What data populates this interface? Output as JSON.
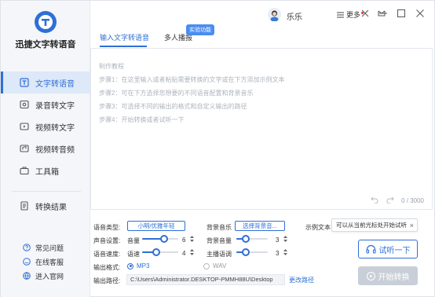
{
  "app": {
    "name": "迅捷文字转语音"
  },
  "colors": {
    "accent": "#2f6fd6",
    "sidebar_bg": "#f4f6f9",
    "active_bg": "#dde8f8",
    "badge": "#4a8df0"
  },
  "sidebar": {
    "items": [
      {
        "label": "文字转语音",
        "icon": "text-to-speech-icon",
        "active": true
      },
      {
        "label": "录音转文字",
        "icon": "recording-icon",
        "active": false
      },
      {
        "label": "视频转文字",
        "icon": "video-text-icon",
        "active": false
      },
      {
        "label": "视频转音频",
        "icon": "video-audio-icon",
        "active": false
      },
      {
        "label": "工具箱",
        "icon": "toolbox-icon",
        "active": false
      }
    ],
    "result": {
      "label": "转换结果",
      "icon": "result-icon"
    },
    "bottom_links": [
      {
        "label": "常见问题",
        "icon": "question-icon"
      },
      {
        "label": "在线客服",
        "icon": "support-icon"
      },
      {
        "label": "进入官网",
        "icon": "website-icon"
      }
    ]
  },
  "header": {
    "username": "乐乐",
    "more_label": "更多"
  },
  "tabs": {
    "input_text": "输入文字转语音",
    "multi_voice": "多人播报",
    "badge": "实验功能"
  },
  "editor": {
    "tutorial": [
      "制作教程",
      "步骤1：在这里输入或者粘贴需要转换的文字或在下方添加示例文本",
      "步骤2：可在下方选择您想要的不同语音配置和背景音乐",
      "步骤3：可选择不同的输出的格式和自定义输出的路径",
      "步骤4：开始转换或者试听一下"
    ],
    "counter": "0 / 3000"
  },
  "settings": {
    "voice_type_label": "语音类型:",
    "voice_type_value": "小明/优雅年轻",
    "bg_music_label": "背景音乐",
    "bg_music_value": "选择背景音...",
    "sample_text_label": "示例文本",
    "voice_settings_label": "声音设置:",
    "volume_label": "音量",
    "volume_value": "6",
    "volume_level": 0.6,
    "bg_volume_label": "背景音量",
    "bg_volume_value": "3",
    "bg_volume_level": 0.3,
    "speed_label": "语音速度:",
    "rate_label": "语速",
    "rate_value": "4",
    "rate_level": 0.4,
    "pitch_label": "主播语调",
    "pitch_value": "3",
    "pitch_level": 0.3,
    "format_label": "输出格式:",
    "format_mp3": "MP3",
    "format_wav": "WAV",
    "path_label": "输出路径:",
    "path_value": "C:\\Users\\Administrator.DESKTOP-PMMH88U\\Desktop",
    "change_path": "更改路径"
  },
  "tooltip": {
    "text": "可以从当前光标处开始试听"
  },
  "buttons": {
    "trial": "试听一下",
    "convert": "开始转换"
  }
}
